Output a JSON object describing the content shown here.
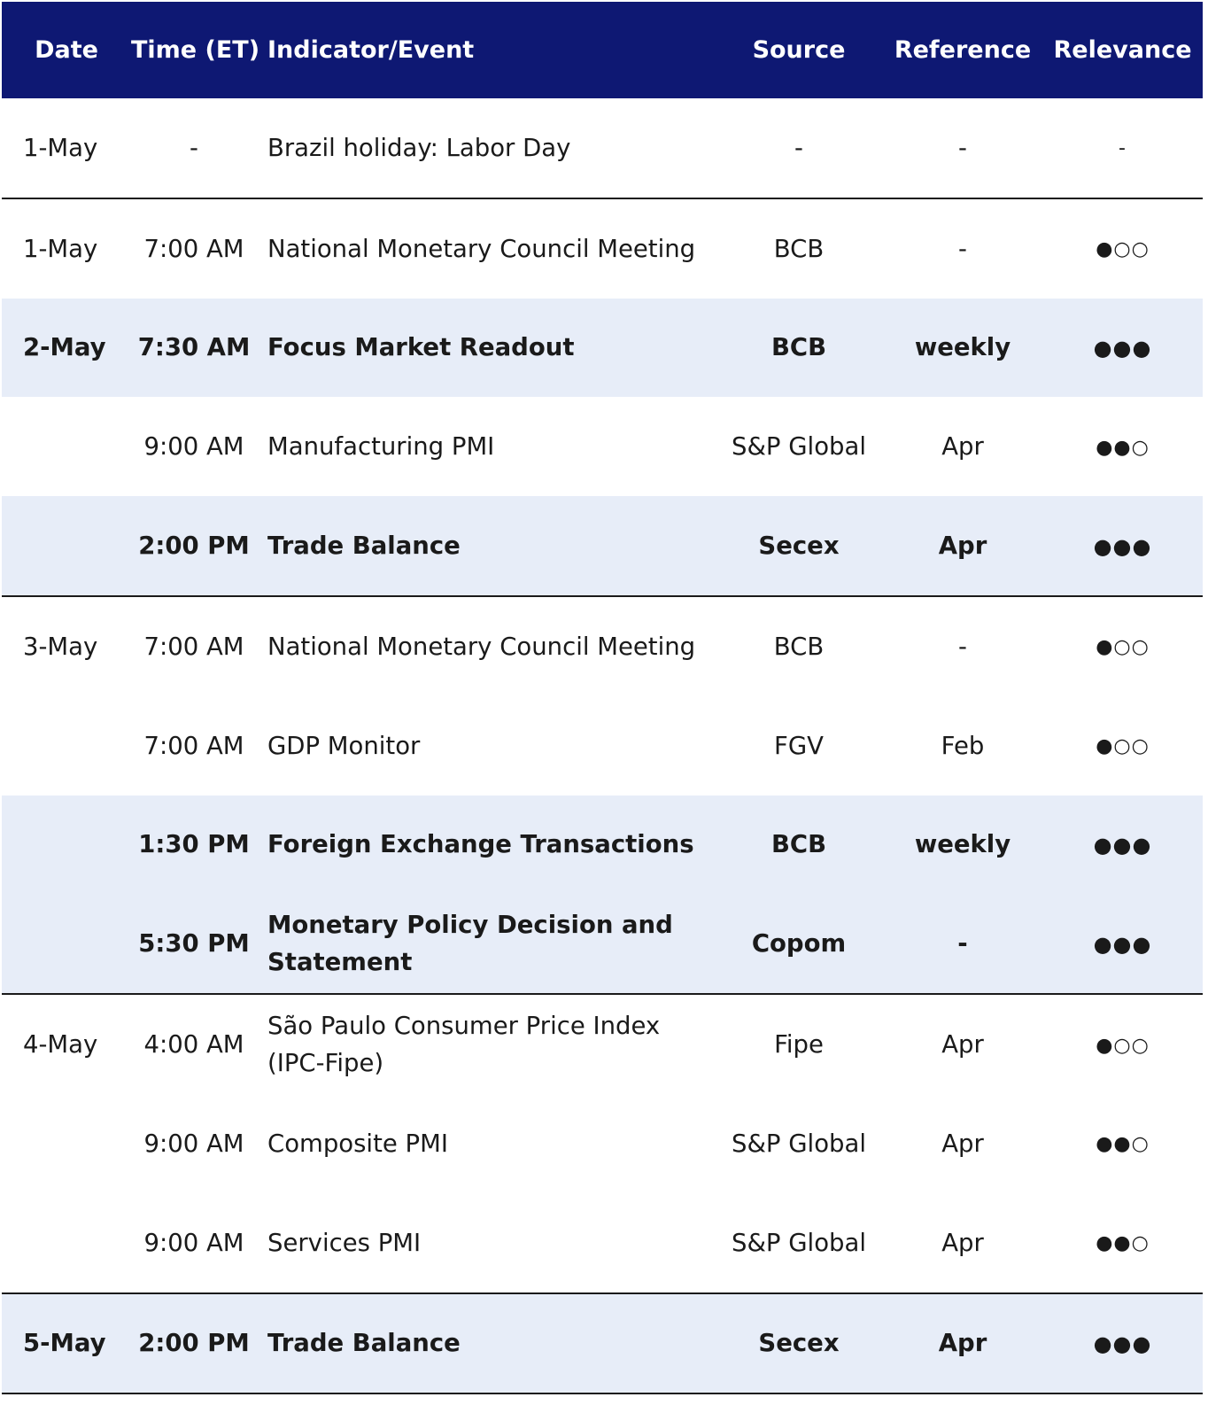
{
  "header": {
    "date": "Date",
    "time": "Time (ET)",
    "event": "Indicator/Event",
    "source": "Source",
    "reference": "Reference",
    "relevance": "Relevance"
  },
  "colors": {
    "header_bg": "#0e1873",
    "highlight_bg": "#e7edf8"
  },
  "rows": [
    {
      "date": "1-May",
      "time": "-",
      "event": "Brazil holiday: Labor Day",
      "source": "-",
      "reference": "-",
      "relevance": "-",
      "highlight": false,
      "bold": false
    },
    {
      "date": "1-May",
      "time": "7:00 AM",
      "event": "National Monetary Council Meeting",
      "source": "BCB",
      "reference": "-",
      "relevance": "●○○",
      "highlight": false,
      "bold": false
    },
    {
      "date": "2-May",
      "time": "7:30 AM",
      "event": "Focus Market Readout",
      "source": "BCB",
      "reference": "weekly",
      "relevance": "●●●",
      "highlight": true,
      "bold": true
    },
    {
      "date": "",
      "time": "9:00 AM",
      "event": "Manufacturing PMI",
      "source": "S&P Global",
      "reference": "Apr",
      "relevance": "●●○",
      "highlight": false,
      "bold": false
    },
    {
      "date": "",
      "time": "2:00 PM",
      "event": "Trade Balance",
      "source": "Secex",
      "reference": "Apr",
      "relevance": "●●●",
      "highlight": true,
      "bold": true
    },
    {
      "date": "3-May",
      "time": "7:00 AM",
      "event": "National Monetary Council Meeting",
      "source": "BCB",
      "reference": "-",
      "relevance": "●○○",
      "highlight": false,
      "bold": false
    },
    {
      "date": "",
      "time": "7:00 AM",
      "event": "GDP Monitor",
      "source": "FGV",
      "reference": "Feb",
      "relevance": "●○○",
      "highlight": false,
      "bold": false
    },
    {
      "date": "",
      "time": "1:30 PM",
      "event": "Foreign Exchange Transactions",
      "source": "BCB",
      "reference": "weekly",
      "relevance": "●●●",
      "highlight": true,
      "bold": true
    },
    {
      "date": "",
      "time": "5:30 PM",
      "event": "Monetary Policy Decision and Statement",
      "source": "Copom",
      "reference": "-",
      "relevance": "●●●",
      "highlight": true,
      "bold": true
    },
    {
      "date": "4-May",
      "time": "4:00 AM",
      "event": "São Paulo Consumer Price Index (IPC-Fipe)",
      "source": "Fipe",
      "reference": "Apr",
      "relevance": "●○○",
      "highlight": false,
      "bold": false
    },
    {
      "date": "",
      "time": "9:00 AM",
      "event": "Composite PMI",
      "source": "S&P Global",
      "reference": "Apr",
      "relevance": "●●○",
      "highlight": false,
      "bold": false
    },
    {
      "date": "",
      "time": "9:00 AM",
      "event": "Services PMI",
      "source": "S&P Global",
      "reference": "Apr",
      "relevance": "●●○",
      "highlight": false,
      "bold": false
    },
    {
      "date": "5-May",
      "time": "2:00 PM",
      "event": "Trade Balance",
      "source": "Secex",
      "reference": "Apr",
      "relevance": "●●●",
      "highlight": true,
      "bold": true
    }
  ]
}
